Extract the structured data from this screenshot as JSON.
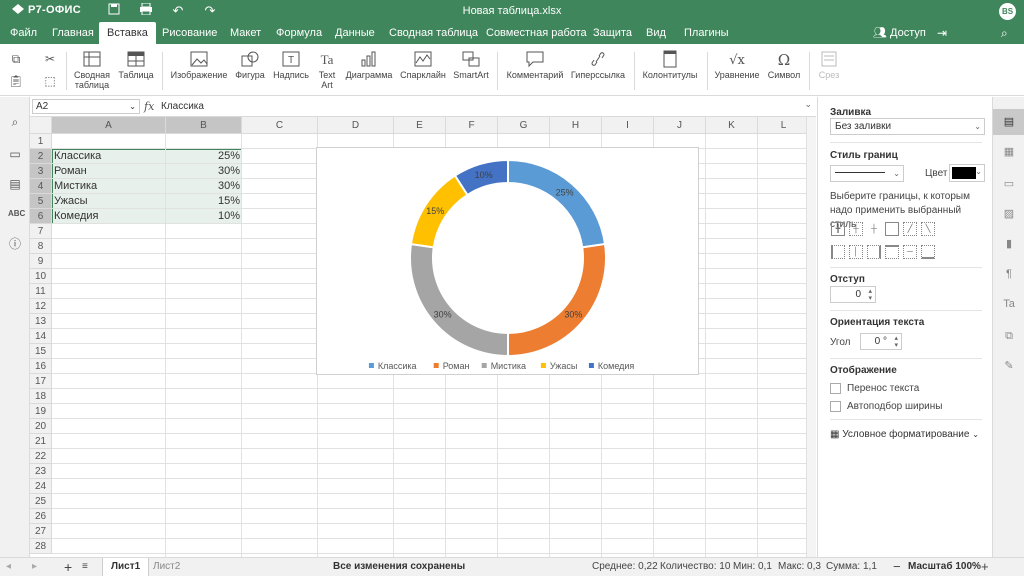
{
  "app": {
    "logo": "Р7-ОФИС",
    "doc_title": "Новая таблица.xlsx",
    "user_initials": "BS",
    "brand_color": "#40865c"
  },
  "menu": {
    "tabs": [
      "Файл",
      "Главная",
      "Вставка",
      "Рисование",
      "Макет",
      "Формула",
      "Данные",
      "Сводная таблица",
      "Совместная работа",
      "Защита",
      "Вид",
      "Плагины"
    ],
    "active_tab": "Вставка",
    "access": "Доступ"
  },
  "ribbon": {
    "pivot_table": "Сводная\nтаблица",
    "table": "Таблица",
    "image": "Изображение",
    "shape": "Фигура",
    "caption": "Надпись",
    "text_art": "Text\nArt",
    "chart": "Диаграмма",
    "sparkline": "Спарклайн",
    "smartart": "SmartArt",
    "comment": "Комментарий",
    "hyperlink": "Гиперссылка",
    "header_footer": "Колонтитулы",
    "equation": "Уравнение",
    "symbol": "Символ",
    "slicer": "Срез"
  },
  "formula_bar": {
    "cell_ref": "A2",
    "fx": "fx",
    "value": "Классика"
  },
  "columns": [
    "A",
    "B",
    "C",
    "D",
    "E",
    "F",
    "G",
    "H",
    "I",
    "J",
    "K",
    "L"
  ],
  "rows": [
    "1",
    "2",
    "3",
    "4",
    "5",
    "6",
    "7",
    "8",
    "9",
    "10",
    "11",
    "12",
    "13",
    "14",
    "15",
    "16",
    "17",
    "18",
    "19",
    "20",
    "21",
    "22",
    "23",
    "24",
    "25",
    "26",
    "27",
    "28"
  ],
  "cells": [
    {
      "a": "Классика",
      "b": "25%"
    },
    {
      "a": "Роман",
      "b": "30%"
    },
    {
      "a": "Мистика",
      "b": "30%"
    },
    {
      "a": "Ужасы",
      "b": "15%"
    },
    {
      "a": "Комедия",
      "b": "10%"
    }
  ],
  "chart_data": {
    "type": "pie",
    "variant": "doughnut",
    "categories": [
      "Классика",
      "Роман",
      "Мистика",
      "Ужасы",
      "Комедия"
    ],
    "values": [
      25,
      30,
      30,
      15,
      10
    ],
    "data_labels": [
      "25%",
      "30%",
      "30%",
      "15%",
      "10%"
    ],
    "colors": [
      "#5b9bd5",
      "#ed7d31",
      "#a5a5a5",
      "#ffc000",
      "#4472c4"
    ],
    "legend_position": "bottom",
    "title": ""
  },
  "right_panel": {
    "fill_title": "Заливка",
    "fill_value": "Без заливки",
    "border_style_title": "Стиль границ",
    "color_label": "Цвет",
    "border_hint": "Выберите границы, к которым надо применить выбранный стиль",
    "indent_title": "Отступ",
    "indent_value": "0",
    "orientation_title": "Ориентация текста",
    "angle_label": "Угол",
    "angle_value": "0 °",
    "display_title": "Отображение",
    "wrap_text": "Перенос текста",
    "autofit": "Автоподбор ширины",
    "conditional_formatting": "Условное форматирование"
  },
  "status": {
    "sheets": [
      "Лист1",
      "Лист2"
    ],
    "active_sheet": "Лист1",
    "saved": "Все изменения сохранены",
    "average": "Среднее: 0,22",
    "count": "Количество: 10",
    "min": "Мин: 0,1",
    "max": "Макс: 0,3",
    "sum": "Сумма: 1,1",
    "zoom": "Масштаб 100%"
  }
}
